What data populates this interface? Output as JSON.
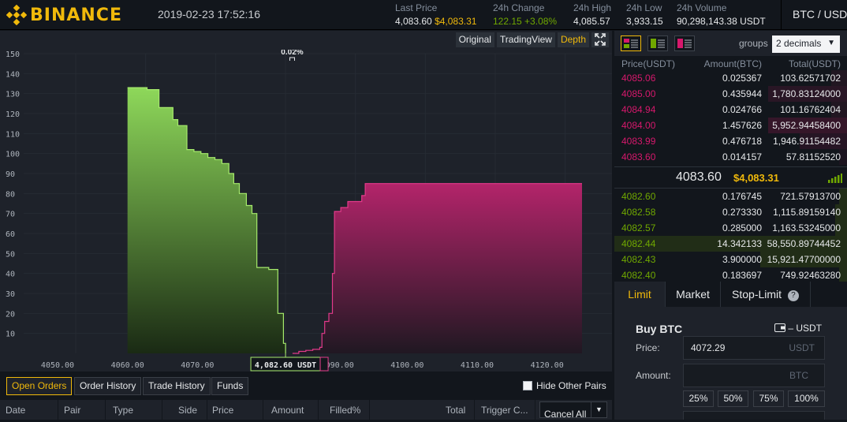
{
  "header": {
    "logo_text": "BINANCE",
    "datetime": "2019-02-23 17:52:16",
    "stats": [
      {
        "label": "Last Price",
        "value": "4,083.60",
        "value2": "$4,083.31"
      },
      {
        "label": "24h Change",
        "value": "122.15",
        "value2": "+3.08%"
      },
      {
        "label": "24h High",
        "value": "4,085.57"
      },
      {
        "label": "24h Low",
        "value": "3,933.15"
      },
      {
        "label": "24h Volume",
        "value": "90,298,143.38 USDT"
      }
    ],
    "pair": "BTC / USDT"
  },
  "chart_tabs": [
    "Original",
    "TradingView",
    "Depth"
  ],
  "chart_active_tab": "Depth",
  "chart_data": {
    "type": "area",
    "title": "",
    "spread_label": "0.02%",
    "mid_label": "4,082.60 USDT",
    "ylim": [
      0,
      150
    ],
    "xlim": [
      4050,
      4125
    ],
    "yticks": [
      10,
      20,
      30,
      40,
      50,
      60,
      70,
      80,
      90,
      100,
      110,
      120,
      130,
      140,
      150
    ],
    "xticks": [
      "4050.00",
      "4060.00",
      "4070.00",
      "4080.00",
      "4090.00",
      "4100.00",
      "4110.00",
      "4120.00"
    ],
    "series": [
      {
        "side": "bids",
        "color": "#70c030",
        "x": [
          4060,
          4062.8,
          4064.5,
          4066.5,
          4067.2,
          4068.5,
          4069.5,
          4070.5,
          4071.5,
          4072.5,
          4073.5,
          4074.5,
          4075.2,
          4076,
          4077,
          4077.8,
          4078.5,
          4080.2,
          4081.5,
          4082.3,
          4082.6
        ],
        "y": [
          133,
          132,
          123,
          117,
          114,
          102,
          101,
          100,
          98,
          97,
          95,
          90,
          85,
          80,
          74,
          70,
          43,
          42,
          20,
          5,
          0
        ]
      },
      {
        "side": "asks",
        "color": "#c0256a",
        "x": [
          4083.6,
          4084.5,
          4085.5,
          4086.5,
          4087.5,
          4087.8,
          4088.2,
          4088.8,
          4089.3,
          4089.6,
          4090.5,
          4091.5,
          4093.5,
          4094,
          4125
        ],
        "y": [
          0,
          1,
          1.5,
          2,
          3,
          10,
          16,
          20,
          40,
          71,
          73,
          76,
          79,
          85,
          85
        ]
      }
    ]
  },
  "orderbook": {
    "group_icons": [
      "both-sides-icon",
      "bids-only-icon",
      "asks-only-icon"
    ],
    "groups_label": "groups",
    "decimals": "2 decimals",
    "columns": [
      "Price(USDT)",
      "Amount(BTC)",
      "Total(USDT)"
    ],
    "asks": [
      {
        "price": "4085.06",
        "amount": "0.025367",
        "total": "103.62571702"
      },
      {
        "price": "4085.00",
        "amount": "0.435944",
        "total": "1,780.83124000"
      },
      {
        "price": "4084.94",
        "amount": "0.024766",
        "total": "101.16762404"
      },
      {
        "price": "4084.00",
        "amount": "1.457626",
        "total": "5,952.94458400"
      },
      {
        "price": "4083.99",
        "amount": "0.476718",
        "total": "1,946.91154482"
      },
      {
        "price": "4083.60",
        "amount": "0.014157",
        "total": "57.81152520"
      }
    ],
    "last_price": "4083.60",
    "last_price_usd": "$4,083.31",
    "bids": [
      {
        "price": "4082.60",
        "amount": "0.176745",
        "total": "721.57913700"
      },
      {
        "price": "4082.58",
        "amount": "0.273330",
        "total": "1,115.89159140"
      },
      {
        "price": "4082.57",
        "amount": "0.285000",
        "total": "1,163.53245000"
      },
      {
        "price": "4082.44",
        "amount": "14.342133",
        "total": "58,550.89744452"
      },
      {
        "price": "4082.43",
        "amount": "3.900000",
        "total": "15,921.47700000"
      },
      {
        "price": "4082.40",
        "amount": "0.183697",
        "total": "749.92463280"
      }
    ]
  },
  "order_form": {
    "tabs": [
      "Limit",
      "Market",
      "Stop-Limit"
    ],
    "active_tab": "Limit",
    "title": "Buy BTC",
    "balance": "– USDT",
    "price_label": "Price:",
    "price_value": "4072.29",
    "price_unit": "USDT",
    "amount_label": "Amount:",
    "amount_unit": "BTC",
    "percents": [
      "25%",
      "50%",
      "75%",
      "100%"
    ]
  },
  "orders": {
    "tabs": [
      "Open Orders",
      "Order History",
      "Trade History",
      "Funds"
    ],
    "active_tab": "Open Orders",
    "hide_other_pairs": "Hide Other Pairs",
    "columns": [
      "Date",
      "Pair",
      "Type",
      "Side",
      "Price",
      "Amount",
      "Filled%",
      "Total",
      "Trigger C..."
    ],
    "cancel_all": "Cancel All"
  }
}
